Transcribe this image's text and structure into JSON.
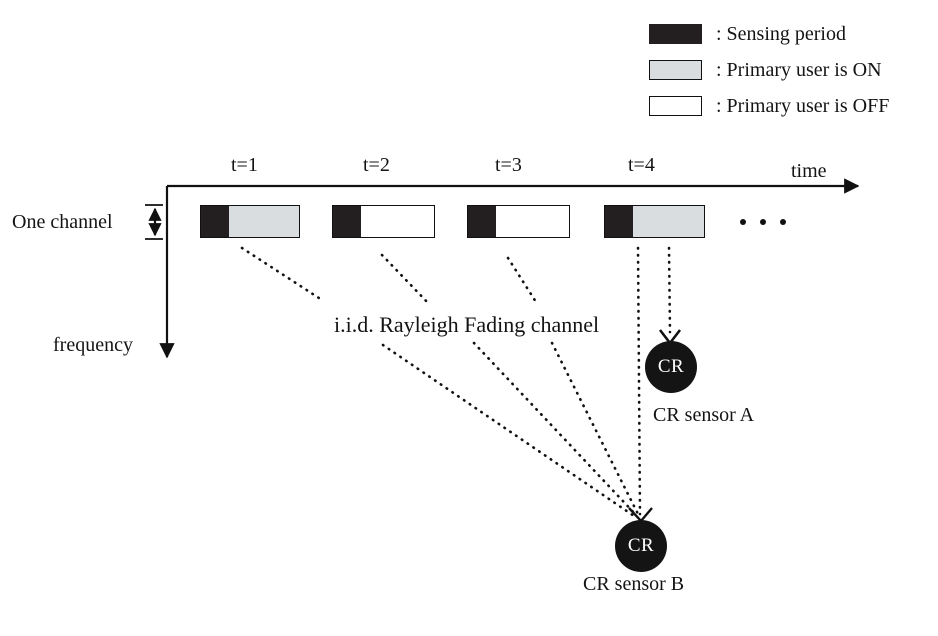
{
  "figure": {
    "title_absent": true,
    "legend": {
      "items": [
        {
          "swatch": "black-swatch",
          "color": "#231f20",
          "label": ": Sensing period"
        },
        {
          "swatch": "gray-swatch",
          "color": "#dadddf",
          "label": ": Primary user is ON"
        },
        {
          "swatch": "white-swatch",
          "color": "#ffffff",
          "label": ": Primary user is OFF"
        }
      ]
    },
    "axes": {
      "time_label": "time",
      "frequency_label": "frequency",
      "channel_label": "One channel"
    },
    "timeline": {
      "slots": [
        {
          "tick": "t=1",
          "sensing": "Sensing period",
          "state": "ON",
          "state_color": "#dadddf"
        },
        {
          "tick": "t=2",
          "sensing": "Sensing period",
          "state": "OFF",
          "state_color": "#ffffff"
        },
        {
          "tick": "t=3",
          "sensing": "Sensing period",
          "state": "OFF",
          "state_color": "#ffffff"
        },
        {
          "tick": "t=4",
          "sensing": "Sensing period",
          "state": "ON",
          "state_color": "#dadddf"
        }
      ],
      "continuation": "..."
    },
    "channel_note": "i.i.d. Rayleigh Fading channel",
    "sensors": [
      {
        "node_text": "CR",
        "caption": "CR sensor A"
      },
      {
        "node_text": "CR",
        "caption": "CR sensor B"
      }
    ]
  }
}
